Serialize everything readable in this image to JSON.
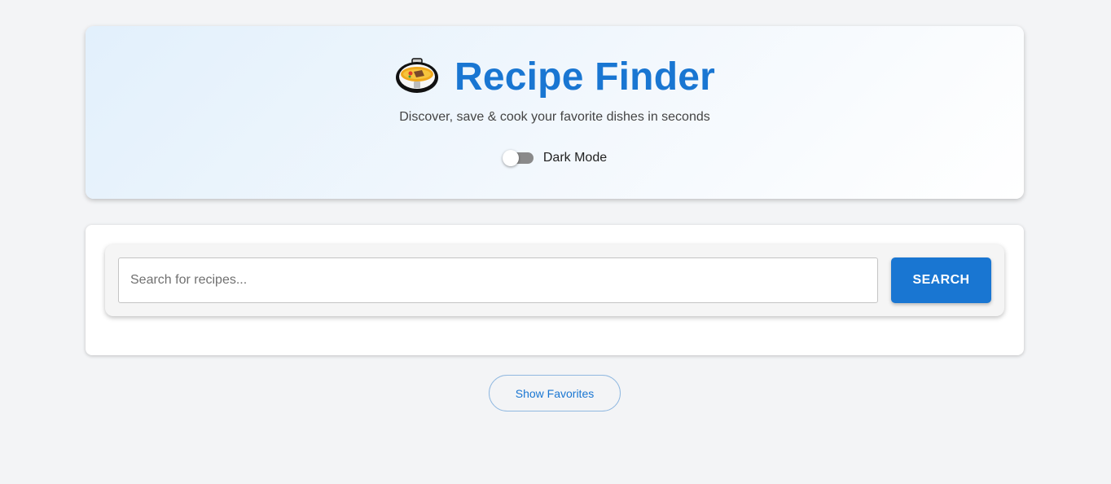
{
  "header": {
    "icon": "pot-of-food-icon",
    "title": "Recipe Finder",
    "subtitle": "Discover, save & cook your favorite dishes in seconds",
    "dark_mode": {
      "label": "Dark Mode",
      "enabled": false
    }
  },
  "search": {
    "placeholder": "Search for recipes...",
    "value": "",
    "button_label": "SEARCH"
  },
  "favorites": {
    "button_label": "Show Favorites"
  },
  "colors": {
    "accent": "#1976d2",
    "page_background": "#f3f4f6",
    "toggle_track_off": "#8a8a8a"
  }
}
